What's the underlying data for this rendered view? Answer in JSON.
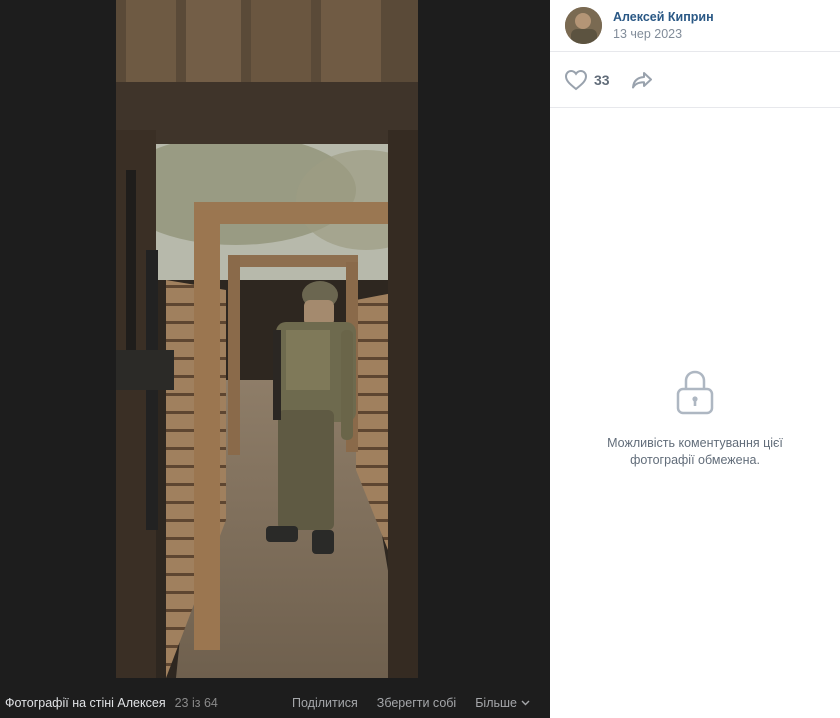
{
  "viewer": {
    "album_title": "Фотографії на стіні Алексея",
    "counter": "23 із 64",
    "actions": {
      "share": "Поділитися",
      "save": "Зберегти собі",
      "more": "Більше"
    }
  },
  "sidebar": {
    "author_name": "Алексей Киприн",
    "date": "13 чер 2023",
    "likes": "33",
    "comments_locked": "Можливість коментування цієї фотографії обмежена."
  },
  "colors": {
    "link": "#2a5885",
    "secondary_text": "#818c99",
    "icon": "#99a2ad",
    "viewer_bg": "#1d1d1d"
  },
  "icons": [
    "heart-icon",
    "share-icon",
    "lock-icon",
    "chevron-down-icon"
  ]
}
